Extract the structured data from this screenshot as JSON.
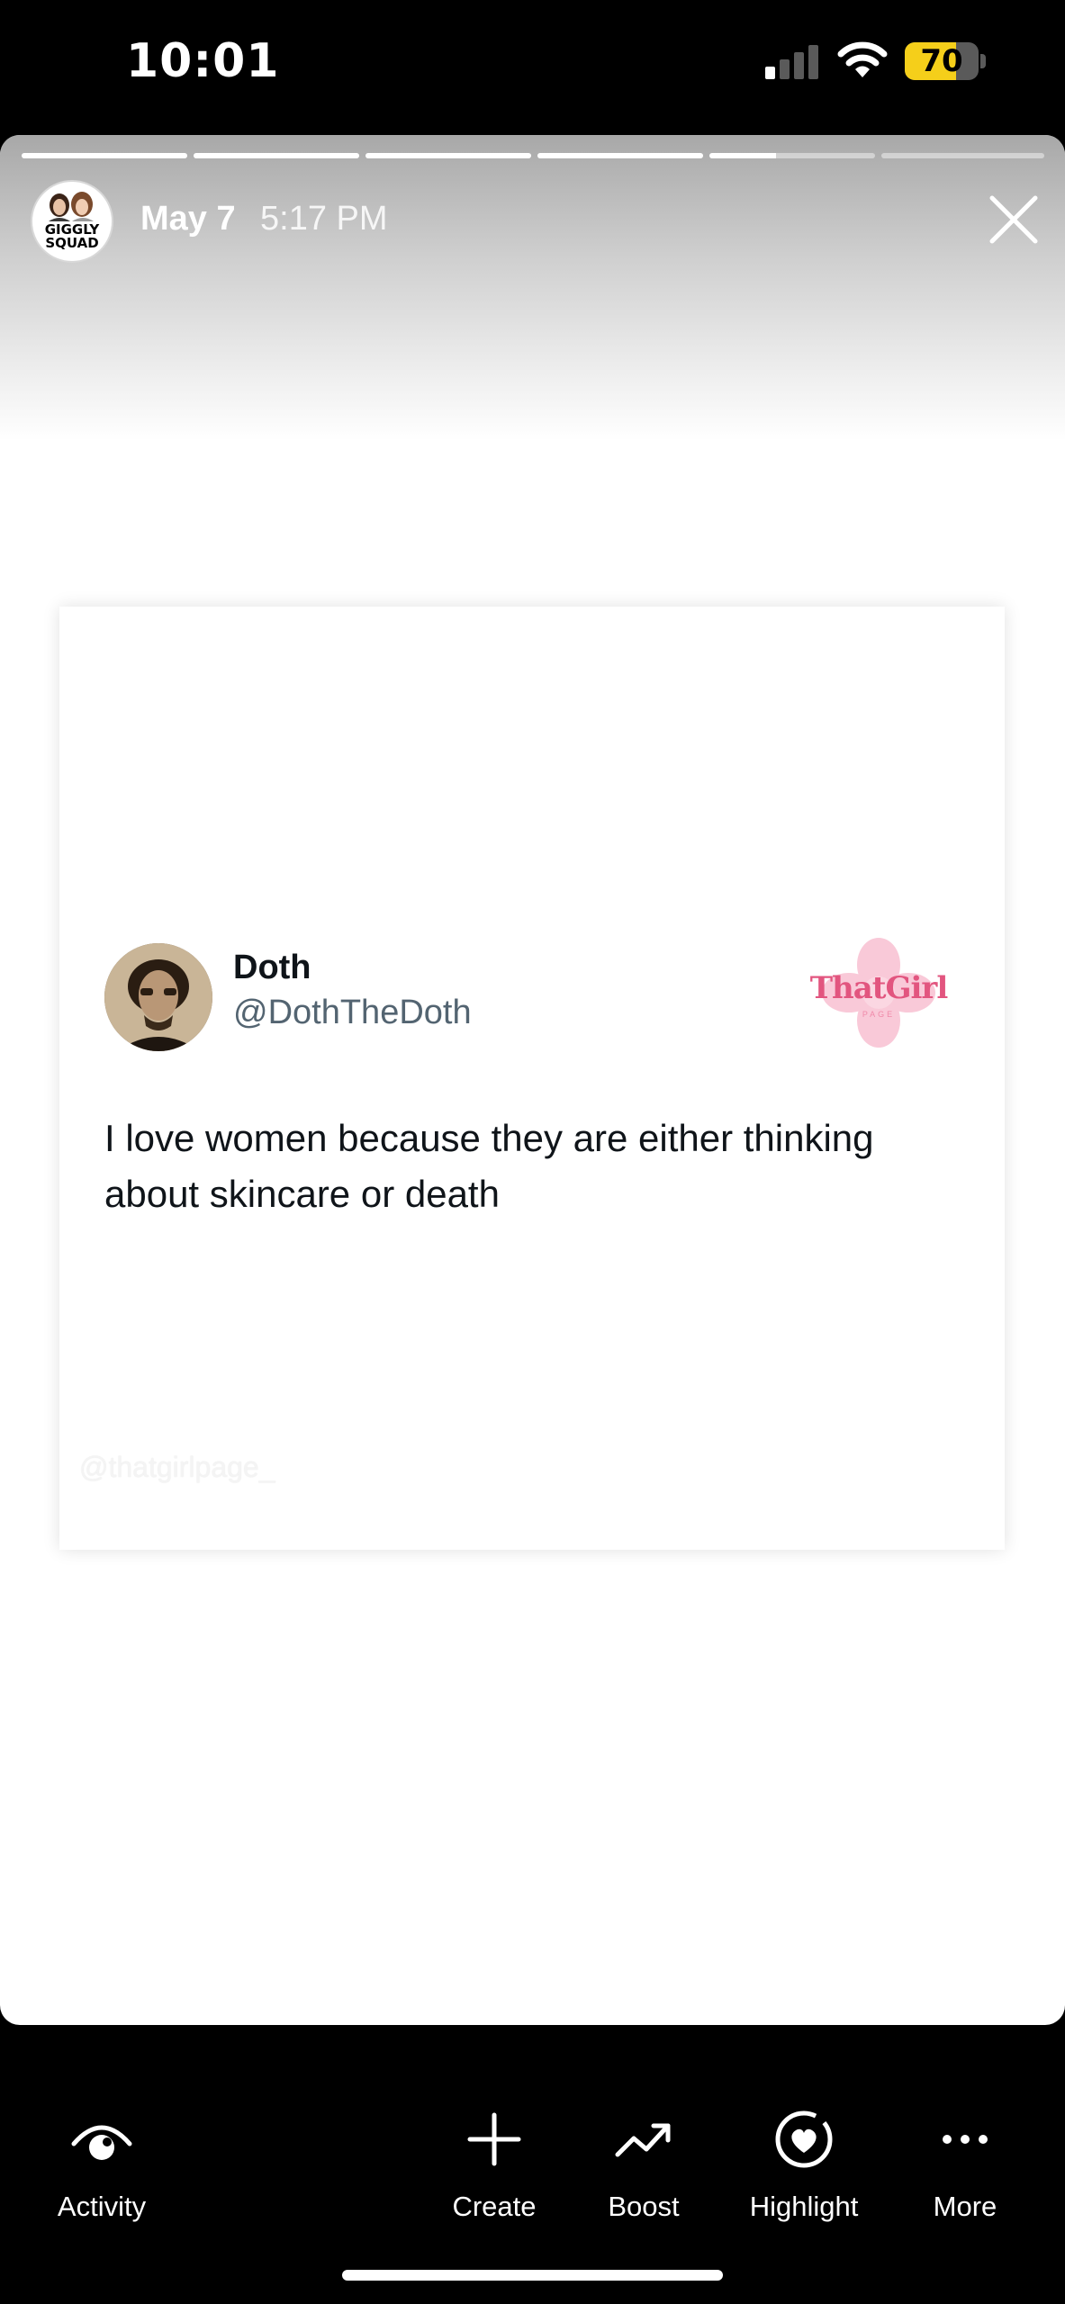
{
  "status_bar": {
    "time": "10:01",
    "battery_level": "70",
    "battery_fraction": 0.7,
    "signal_icon": "cellular-signal-icon",
    "wifi_icon": "wifi-icon"
  },
  "story": {
    "account_avatar_text": "GIGGLY SQUAD",
    "date": "May 7",
    "time": "5:17 PM",
    "close_icon": "close-icon",
    "progress": [
      1,
      1,
      1,
      1,
      0.4,
      0
    ]
  },
  "post": {
    "author_name": "Doth",
    "author_handle": "@DothTheDoth",
    "text": "I love women because they are either thinking about skincare or death",
    "brand_logo_text": "ThatGirl",
    "brand_logo_subtext": "PAGE",
    "watermark": "@thatgirlpage_"
  },
  "actions": [
    {
      "label": "Activity",
      "icon": "activity-eye-icon"
    },
    {
      "label": "Create",
      "icon": "plus-icon"
    },
    {
      "label": "Boost",
      "icon": "trending-up-icon"
    },
    {
      "label": "Highlight",
      "icon": "highlight-heart-icon"
    },
    {
      "label": "More",
      "icon": "more-dots-icon"
    }
  ],
  "colors": {
    "battery": "#f5cf1a",
    "brand_pink": "#e2557f",
    "handle_gray": "#536471"
  }
}
